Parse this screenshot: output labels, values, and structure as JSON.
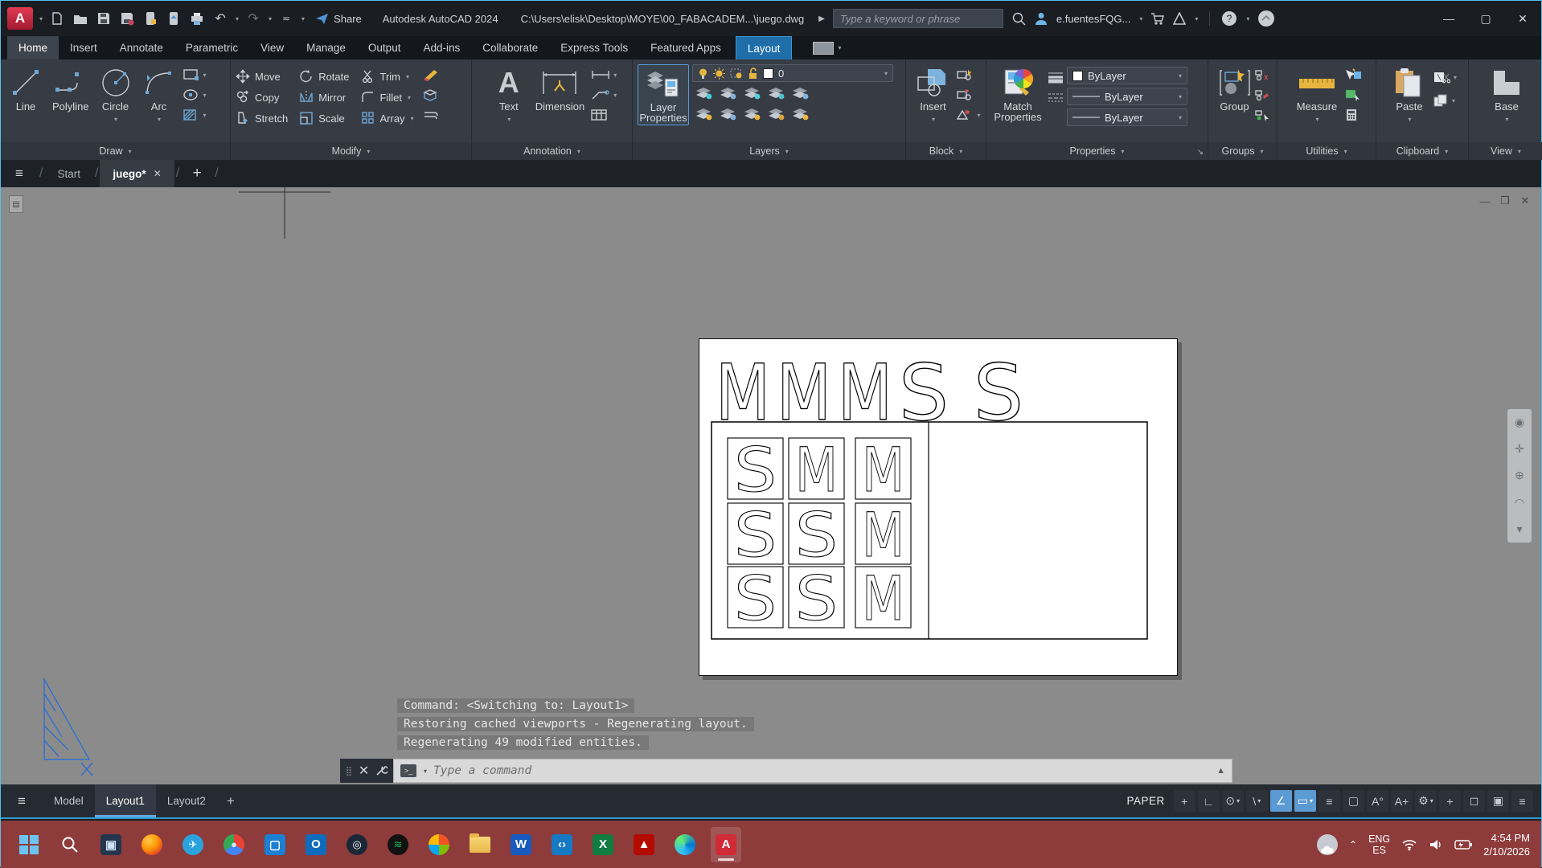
{
  "titlebar": {
    "app_title": "Autodesk AutoCAD 2024",
    "document_path": "C:\\Users\\elisk\\Desktop\\MOYE\\00_FABACADEM...\\juego.dwg",
    "search_placeholder": "Type a keyword or phrase",
    "user_name": "e.fuentesFQG...",
    "share_label": "Share",
    "app_logo_letter": "A"
  },
  "ribbon": {
    "tabs": [
      "Home",
      "Insert",
      "Annotate",
      "Parametric",
      "View",
      "Manage",
      "Output",
      "Add-ins",
      "Collaborate",
      "Express Tools",
      "Featured Apps"
    ],
    "active_tab": "Home",
    "contextual_tab": "Layout",
    "panels": {
      "draw": {
        "label": "Draw",
        "line": "Line",
        "polyline": "Polyline",
        "circle": "Circle",
        "arc": "Arc"
      },
      "modify": {
        "label": "Modify",
        "move": "Move",
        "rotate": "Rotate",
        "trim": "Trim",
        "copy": "Copy",
        "mirror": "Mirror",
        "fillet": "Fillet",
        "stretch": "Stretch",
        "scale": "Scale",
        "array": "Array"
      },
      "annotation": {
        "label": "Annotation",
        "text": "Text",
        "dimension": "Dimension"
      },
      "layers": {
        "label": "Layers",
        "layer_properties": "Layer Properties",
        "current_layer": "0"
      },
      "block": {
        "label": "Block",
        "insert": "Insert"
      },
      "properties": {
        "label": "Properties",
        "match": "Match Properties",
        "color": "ByLayer",
        "lineweight": "ByLayer",
        "linetype": "ByLayer"
      },
      "groups": {
        "label": "Groups",
        "group": "Group"
      },
      "utilities": {
        "label": "Utilities",
        "measure": "Measure"
      },
      "clipboard": {
        "label": "Clipboard",
        "paste": "Paste"
      },
      "view": {
        "label": "View",
        "base": "Base"
      }
    }
  },
  "file_tabs": {
    "start": "Start",
    "document": "juego*"
  },
  "drawing": {
    "top_letters": [
      "M",
      "M",
      "M",
      "S",
      "S"
    ],
    "grid": [
      [
        "S",
        "M",
        "M"
      ],
      [
        "S",
        "S",
        "M"
      ],
      [
        "S",
        "S",
        "M"
      ]
    ]
  },
  "command_line": {
    "placeholder": "Type a command",
    "history": [
      "Command:   <Switching to: Layout1>",
      "Restoring cached viewports - Regenerating layout.",
      "Regenerating 49 modified entities."
    ]
  },
  "status_bar": {
    "model_tab": "Model",
    "layout1_tab": "Layout1",
    "layout2_tab": "Layout2",
    "paper_label": "PAPER",
    "icons": [
      {
        "name": "snap-mode",
        "glyph": "+"
      },
      {
        "name": "ortho-mode",
        "glyph": "∟"
      },
      {
        "name": "polar-tracking",
        "glyph": "⊙",
        "caret": true
      },
      {
        "name": "isometric-drafting",
        "glyph": "\\",
        "caret": true
      },
      {
        "name": "object-snap-tracking",
        "glyph": "∠",
        "active": true
      },
      {
        "name": "object-snap",
        "glyph": "▭",
        "active": true,
        "caret": true
      },
      {
        "name": "lineweight-display",
        "glyph": "≡"
      },
      {
        "name": "selection-cycling",
        "glyph": "▢"
      },
      {
        "name": "annotation-visibility",
        "glyph": "A°"
      },
      {
        "name": "autoscale-annotation",
        "glyph": "A+"
      },
      {
        "name": "annotation-scale",
        "glyph": "⚙",
        "caret": true
      },
      {
        "name": "workspace-switching",
        "glyph": "+"
      },
      {
        "name": "isolate-objects",
        "glyph": "◻"
      },
      {
        "name": "clean-screen",
        "glyph": "▣"
      },
      {
        "name": "customization-menu",
        "glyph": "≡"
      }
    ]
  },
  "taskbar": {
    "icons": [
      {
        "name": "windows-start",
        "kind": "win",
        "glyph": ""
      },
      {
        "name": "search",
        "kind": "search",
        "glyph": ""
      },
      {
        "name": "app-window",
        "kind": "tile",
        "bg": "#23364d",
        "fg": "#cfe3f5",
        "glyph": "▣"
      },
      {
        "name": "firefox",
        "kind": "circle",
        "bg": "radial-gradient(circle at 35% 30%,#ffcb4d,#ff9400 45%,#e3452c 78%,#b5007f)",
        "fg": "#fff",
        "glyph": ""
      },
      {
        "name": "telegram",
        "kind": "circle",
        "bg": "#2aa3dd",
        "fg": "#ffffff",
        "glyph": "✈"
      },
      {
        "name": "chrome",
        "kind": "circle",
        "bg": "conic-gradient(#ea4335 0 33%,#4285f4 33% 66%,#34a853 66% 100%)",
        "fg": "#cfe2ff",
        "glyph": "●"
      },
      {
        "name": "microsoft-store",
        "kind": "tile",
        "bg": "#1b7fd4",
        "fg": "#ffffff",
        "glyph": "▢"
      },
      {
        "name": "outlook",
        "kind": "tile",
        "bg": "#0f6cbd",
        "fg": "#ffffff",
        "glyph": "O"
      },
      {
        "name": "steam",
        "kind": "circle",
        "bg": "#1b2838",
        "fg": "#ffffff",
        "glyph": "◎"
      },
      {
        "name": "spotify",
        "kind": "circle",
        "bg": "#121212",
        "fg": "#1db954",
        "glyph": "≋"
      },
      {
        "name": "photos",
        "kind": "circle",
        "bg": "conic-gradient(#f35325 0 25%,#81bc06 25% 50%,#05a6f0 50% 75%,#ffba08 75% 100%)",
        "fg": "#fff",
        "glyph": ""
      },
      {
        "name": "file-explorer",
        "kind": "folder",
        "glyph": ""
      },
      {
        "name": "word",
        "kind": "tile",
        "bg": "#185abd",
        "fg": "#ffffff",
        "glyph": "W"
      },
      {
        "name": "vscode",
        "kind": "tile",
        "bg": "#1579c4",
        "fg": "#ffffff",
        "glyph": "‹›"
      },
      {
        "name": "excel",
        "kind": "tile",
        "bg": "#107c41",
        "fg": "#ffffff",
        "glyph": "X"
      },
      {
        "name": "acrobat",
        "kind": "tile",
        "bg": "#b30b00",
        "fg": "#ffffff",
        "glyph": "▲"
      },
      {
        "name": "edge",
        "kind": "circle",
        "bg": "conic-gradient(from 200deg,#35c1f1,#66eb6e,#0078d7 70%,#35c1f1)",
        "fg": "#fff",
        "glyph": ""
      },
      {
        "name": "autocad",
        "kind": "tile",
        "bg": "#d22b38",
        "fg": "#ffffff",
        "glyph": "A",
        "active": true
      }
    ],
    "tray": {
      "language_line1": "ENG",
      "language_line2": "ES",
      "time": "4:54 PM",
      "date": "2/10/2026"
    }
  },
  "colors": {
    "accent": "#54c0e8",
    "contextual": "#1e6ea9",
    "selection": "#5b9ad2",
    "taskbar": "#8e3b3b",
    "canvas": "#8b8b8b",
    "paper": "#ffffff",
    "autocad_red": "#c2273c"
  }
}
